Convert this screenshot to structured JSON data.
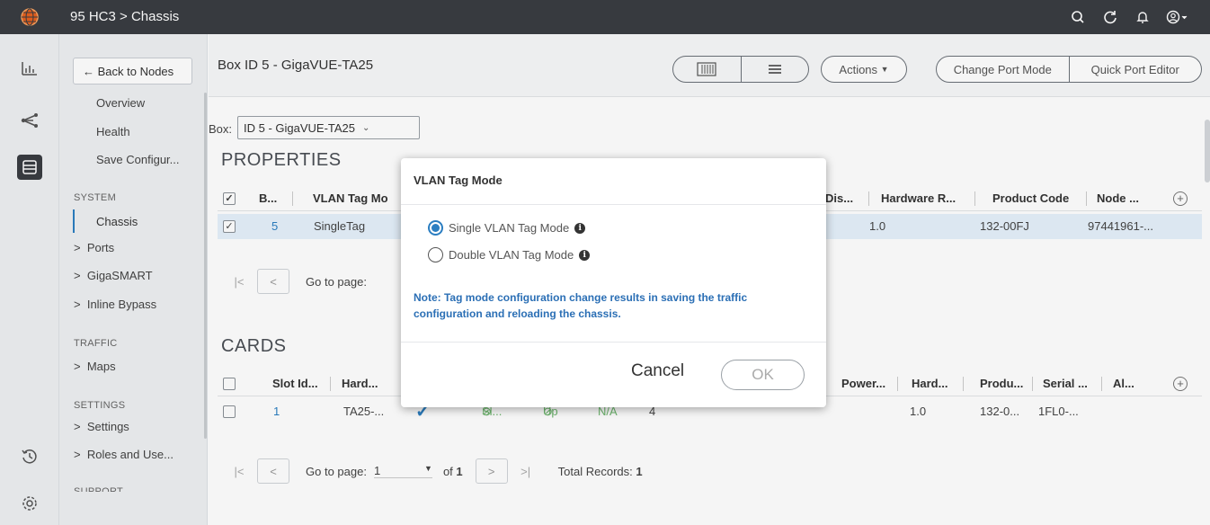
{
  "topbar": {
    "title": "95 HC3 > Chassis",
    "icons": [
      "search-icon",
      "refresh-icon",
      "bell-icon",
      "user-icon"
    ]
  },
  "rail": {
    "icons": [
      "dashboard-icon",
      "topology-icon",
      "inventory-icon",
      "history-icon",
      "settings-icon"
    ]
  },
  "nav": {
    "back_label": "← Back to Nodes",
    "top_items": [
      "Overview",
      "Health",
      "Save Configur..."
    ],
    "system_section": "SYSTEM",
    "chassis": "Chassis",
    "ports": "Ports",
    "gigasmart": "GigaSMART",
    "inline_bypass": "Inline Bypass",
    "traffic_section": "TRAFFIC",
    "maps": "Maps",
    "settings_section": "SETTINGS",
    "settings": "Settings",
    "roles": "Roles and Use...",
    "support_section": "SUPPORT"
  },
  "header": {
    "title": "Box ID 5 - GigaVUE-TA25",
    "actions_label": "Actions",
    "change_port_mode": "Change Port Mode",
    "quick_port_editor": "Quick Port Editor"
  },
  "box_filter": {
    "label": "Box:",
    "value": "ID 5 - GigaVUE-TA25"
  },
  "properties": {
    "title": "PROPERTIES",
    "columns": [
      "B...",
      "VLAN Tag Mo",
      "Dis...",
      "Hardware R...",
      "Product Code",
      "Node ..."
    ],
    "row": {
      "box": "5",
      "vlan": "SingleTag",
      "hw_rev": "1.0",
      "product_code": "132-00FJ",
      "node": "97441961-..."
    },
    "pager": {
      "goto": "Go to page:"
    }
  },
  "cards": {
    "title": "CARDS",
    "columns": [
      "Slot Id...",
      "Hard...",
      "Power...",
      "Hard...",
      "Produ...",
      "Serial ...",
      "Al..."
    ],
    "row": {
      "slot": "1",
      "hard": "TA25-...",
      "s1": "Sl...",
      "s2": "Up",
      "na": "N/A",
      "four": "4",
      "hw_rev": "1.0",
      "prod": "132-0...",
      "serial": "1FL0-..."
    },
    "pager": {
      "goto": "Go to page:",
      "page": "1",
      "of": "of",
      "total_pages": "1",
      "total_label": "Total Records:",
      "total": "1"
    }
  },
  "modal": {
    "title": "VLAN Tag Mode",
    "option_single": "Single VLAN Tag Mode",
    "option_double": "Double VLAN Tag Mode",
    "selected": "single",
    "note": "Note: Tag mode configuration change results in saving the traffic configuration and reloading the chassis.",
    "cancel": "Cancel",
    "ok": "OK"
  },
  "colors": {
    "topbar": "#3a3d42",
    "accent": "#2b7ec1",
    "logo": "#e5601f",
    "status_green": "#4caf50"
  }
}
